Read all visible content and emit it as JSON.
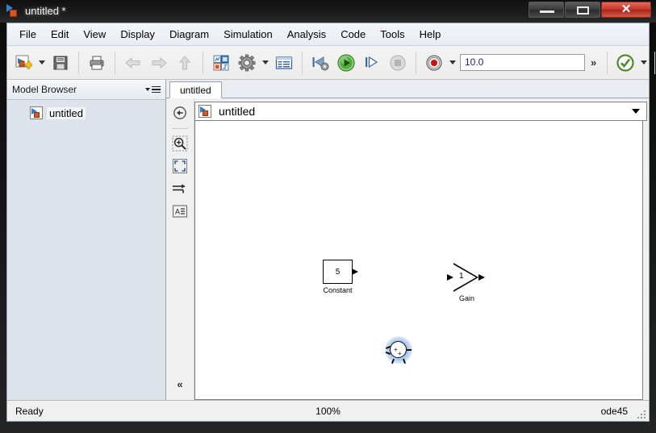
{
  "window": {
    "title": "untitled *",
    "app_icon": "simulink-model-icon",
    "controls": {
      "minimize": "minimize-button",
      "maximize": "maximize-button",
      "close_glyph": "✕"
    }
  },
  "menubar": {
    "items": [
      {
        "label": "File"
      },
      {
        "label": "Edit"
      },
      {
        "label": "View"
      },
      {
        "label": "Display"
      },
      {
        "label": "Diagram"
      },
      {
        "label": "Simulation"
      },
      {
        "label": "Analysis"
      },
      {
        "label": "Code"
      },
      {
        "label": "Tools"
      },
      {
        "label": "Help"
      }
    ]
  },
  "toolbar": {
    "new_model": "new-model-icon",
    "save": "save-icon",
    "print": "print-icon",
    "back": "back-arrow-icon",
    "forward": "forward-arrow-icon",
    "up": "up-arrow-icon",
    "library_browser": "library-browser-icon",
    "model_settings": "gear-icon",
    "model_explorer": "model-explorer-icon",
    "step_back": "step-back-icon",
    "run": "run-icon",
    "step_forward": "step-forward-icon",
    "stop": "stop-icon",
    "record": "record-icon",
    "sim_time_value": "10.0",
    "overflow_label": "»",
    "update_model": "update-model-check-icon",
    "signal_table": "signal-table-icon"
  },
  "browser": {
    "title": "Model Browser",
    "menu_icon": "browser-options-icon",
    "tree": [
      {
        "label": "untitled",
        "icon": "simulink-model-icon"
      }
    ]
  },
  "editor": {
    "tabs": [
      {
        "label": "untitled"
      }
    ],
    "palette": [
      {
        "name": "navigate-back-icon"
      },
      {
        "name": "zoom-region-icon"
      },
      {
        "name": "fit-to-view-icon"
      },
      {
        "name": "signal-routing-icon"
      },
      {
        "name": "annotation-icon"
      }
    ],
    "collapse_label": "«",
    "breadcrumb": {
      "icon": "simulink-model-icon",
      "label": "untitled"
    }
  },
  "canvas": {
    "blocks": [
      {
        "type": "constant",
        "value": "5",
        "label": "Constant"
      },
      {
        "type": "gain",
        "value": "1",
        "label": "Gain"
      }
    ],
    "cursor": {
      "name": "drop-target-cursor",
      "plus_left": "+",
      "plus_right": "+"
    }
  },
  "statusbar": {
    "state": "Ready",
    "zoom": "100%",
    "solver": "ode45"
  },
  "colors": {
    "accent_blue": "#2f7fd0",
    "accent_orange": "#d4581f",
    "run_green": "#3ba93b",
    "record_red": "#cc1111",
    "tree_bg": "#dde3ea"
  }
}
